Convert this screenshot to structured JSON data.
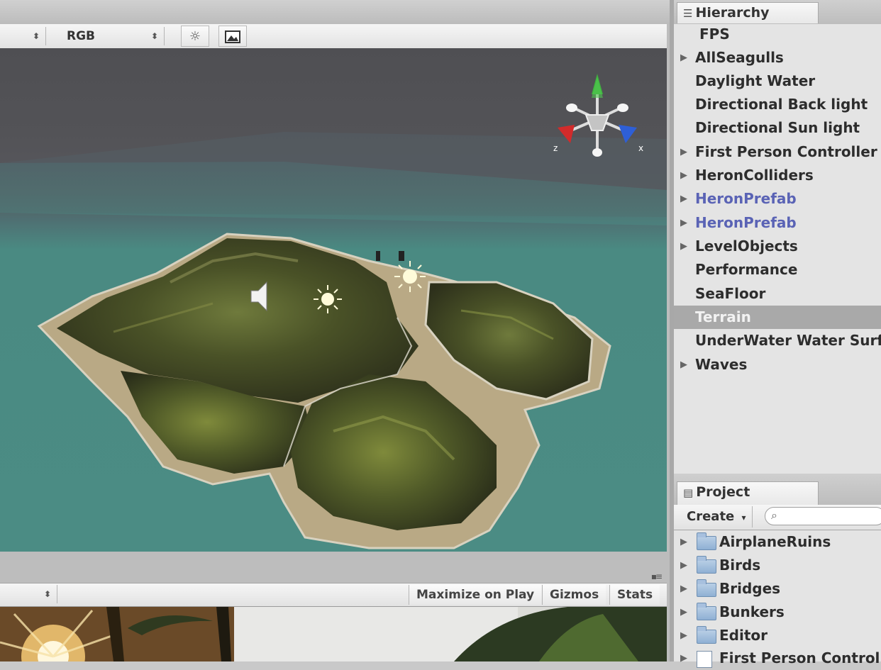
{
  "scene_view": {
    "toolbar": {
      "draw_mode_value": "",
      "render_mode_value": "RGB",
      "lighting_icon": "sun-icon",
      "image_icon": "image-icon"
    }
  },
  "game_view": {
    "toolbar": {
      "aspect_value": "",
      "maximize_on_play": "Maximize on Play",
      "gizmos": "Gizmos",
      "stats": "Stats"
    }
  },
  "hierarchy": {
    "tab_label": "Hierarchy",
    "items": [
      {
        "label": "FPS",
        "expandable": false
      },
      {
        "label": "AllSeagulls",
        "expandable": true
      },
      {
        "label": "Daylight Water",
        "expandable": false
      },
      {
        "label": "Directional Back light",
        "expandable": false
      },
      {
        "label": "Directional Sun light",
        "expandable": false
      },
      {
        "label": "First Person Controller",
        "expandable": true
      },
      {
        "label": "HeronColliders",
        "expandable": true
      },
      {
        "label": "HeronPrefab",
        "expandable": true
      },
      {
        "label": "HeronPrefab",
        "expandable": true
      },
      {
        "label": "LevelObjects",
        "expandable": true
      },
      {
        "label": "Performance",
        "expandable": false
      },
      {
        "label": "SeaFloor",
        "expandable": false
      },
      {
        "label": "Terrain",
        "expandable": false
      },
      {
        "label": "UnderWater Water Surfa",
        "expandable": false
      },
      {
        "label": "Waves",
        "expandable": true
      }
    ]
  },
  "project": {
    "tab_label": "Project",
    "create_label": "Create",
    "search_placeholder": "",
    "items": [
      {
        "label": "AirplaneRuins"
      },
      {
        "label": "Birds"
      },
      {
        "label": "Bridges"
      },
      {
        "label": "Bunkers"
      },
      {
        "label": "Editor"
      },
      {
        "label": "First Person Controll"
      }
    ]
  },
  "colors": {
    "water": "#4b8c84",
    "sky": "#525256",
    "gizmo_y": "#3fb13f",
    "gizmo_x": "#d22b2b",
    "gizmo_z": "#2e5fd6",
    "prefab_text": "#5a63b5",
    "selection": "#a9a9a9"
  }
}
